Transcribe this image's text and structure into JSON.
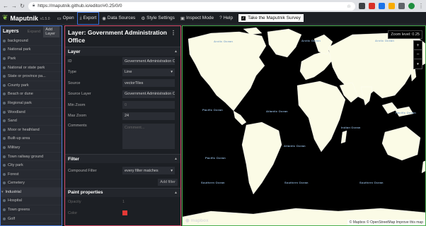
{
  "browser": {
    "url": "https://maputnik.github.io/editor/#0.25/0/0",
    "extensions": [
      {
        "name": "extension-icon-dark",
        "color": "#3c4043"
      },
      {
        "name": "extension-icon-red",
        "color": "#d93025"
      },
      {
        "name": "extension-icon-blue",
        "color": "#1a73e8"
      },
      {
        "name": "extension-icon-yellow",
        "color": "#f9ab00"
      },
      {
        "name": "extension-icon-gray",
        "color": "#5f6368"
      },
      {
        "name": "profile-avatar",
        "color": "#1e8e3e"
      }
    ]
  },
  "app": {
    "name": "Maputnik",
    "version": "v1.5.0",
    "accent_green": "#8bc34a"
  },
  "toolbar": {
    "items": [
      {
        "label": "Open",
        "icon": "open-folder-icon"
      },
      {
        "label": "Export",
        "icon": "download-icon"
      },
      {
        "label": "Data Sources",
        "icon": "database-icon"
      },
      {
        "label": "Style Settings",
        "icon": "gear-icon"
      },
      {
        "label": "Inspect Mode",
        "icon": "inspect-icon"
      },
      {
        "label": "Help",
        "icon": "help-icon"
      }
    ],
    "survey_label": "Take the Maputnik Survey"
  },
  "layers_panel": {
    "title": "Layers",
    "expand_label": "Expand",
    "add_label": "Add Layer",
    "items": [
      {
        "label": "background",
        "group": false
      },
      {
        "label": "National park",
        "group": false
      },
      {
        "label": "Park",
        "group": false
      },
      {
        "label": "National or state park",
        "group": false
      },
      {
        "label": "State or province pa...",
        "group": false
      },
      {
        "label": "County park",
        "group": false
      },
      {
        "label": "Beach or dune",
        "group": false
      },
      {
        "label": "Regional park",
        "group": false
      },
      {
        "label": "Woodland",
        "group": false
      },
      {
        "label": "Sand",
        "group": false
      },
      {
        "label": "Moor or heathland",
        "group": false
      },
      {
        "label": "Built-up area",
        "group": false
      },
      {
        "label": "Military",
        "group": false
      },
      {
        "label": "Town railway ground",
        "group": false
      },
      {
        "label": "City park",
        "group": false
      },
      {
        "label": "Forest",
        "group": false
      },
      {
        "label": "Cemetery",
        "group": false
      },
      {
        "label": "Industrial",
        "group": true
      },
      {
        "label": "Hospital",
        "group": false
      },
      {
        "label": "Town greens",
        "group": false
      },
      {
        "label": "Golf",
        "group": false
      }
    ]
  },
  "editor": {
    "title": "Layer: Government Administration Office",
    "more_icon": "⋮",
    "layer_section": "Layer",
    "fields": [
      {
        "label": "ID",
        "value": "Government Administration O",
        "kind": "input"
      },
      {
        "label": "Type",
        "value": "Line",
        "kind": "select"
      },
      {
        "label": "Source",
        "value": "vectorTiles",
        "kind": "input"
      },
      {
        "label": "Source Layer",
        "value": "Government Administration O",
        "kind": "input"
      },
      {
        "label": "Min Zoom",
        "value": "0",
        "kind": "input-dim"
      },
      {
        "label": "Max Zoom",
        "value": "24",
        "kind": "input"
      }
    ],
    "comments_label": "Comments",
    "comments_placeholder": "Comment...",
    "filter_section": "Filter",
    "compound_filter_label": "Compound Filter",
    "compound_filter_value": "every filter matches",
    "add_filter_label": "Add filter",
    "paint_section": "Paint properties",
    "paint_fields": [
      {
        "label": "Opacity",
        "value": "1"
      },
      {
        "label": "Color",
        "value": ""
      }
    ]
  },
  "map": {
    "zoom_label": "Zoom level:",
    "zoom_value": "0.25",
    "zoom_in": "+",
    "zoom_out": "−",
    "compass": "▼",
    "oceans": [
      {
        "name": "Arctic Ocean"
      },
      {
        "name": "Arctic Ocean"
      },
      {
        "name": "Arctic Ocean"
      },
      {
        "name": "Pacific Ocean"
      },
      {
        "name": "Atlantic Ocean"
      },
      {
        "name": "Indian Ocean"
      },
      {
        "name": "Atlantic Ocean"
      },
      {
        "name": "Pacific Ocean"
      },
      {
        "name": "Pacific Ocean"
      },
      {
        "name": "Southern Ocean"
      },
      {
        "name": "Southern Ocean"
      },
      {
        "name": "Southern Ocean"
      }
    ],
    "logo": "mapbox",
    "attribution": "© Mapbox © OpenStreetMap Improve this map",
    "land_color": "#fbfbe6",
    "water_color": "#000000"
  }
}
